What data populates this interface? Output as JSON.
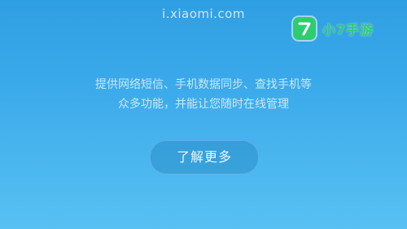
{
  "header": {
    "url_text": "i.xiaomi.com"
  },
  "description": {
    "line1": "提供网络短信、手机数据同步、查找手机等",
    "line2": "众多功能，并能让您随时在线管理"
  },
  "actions": {
    "learn_more_label": "了解更多"
  },
  "watermark": {
    "logo_icon": "seven-logo-icon",
    "brand_text": "小7手游",
    "brand_color": "#2ecc71"
  },
  "colors": {
    "background_top": "#2f9fe3",
    "background_bottom": "#58c0f2"
  }
}
